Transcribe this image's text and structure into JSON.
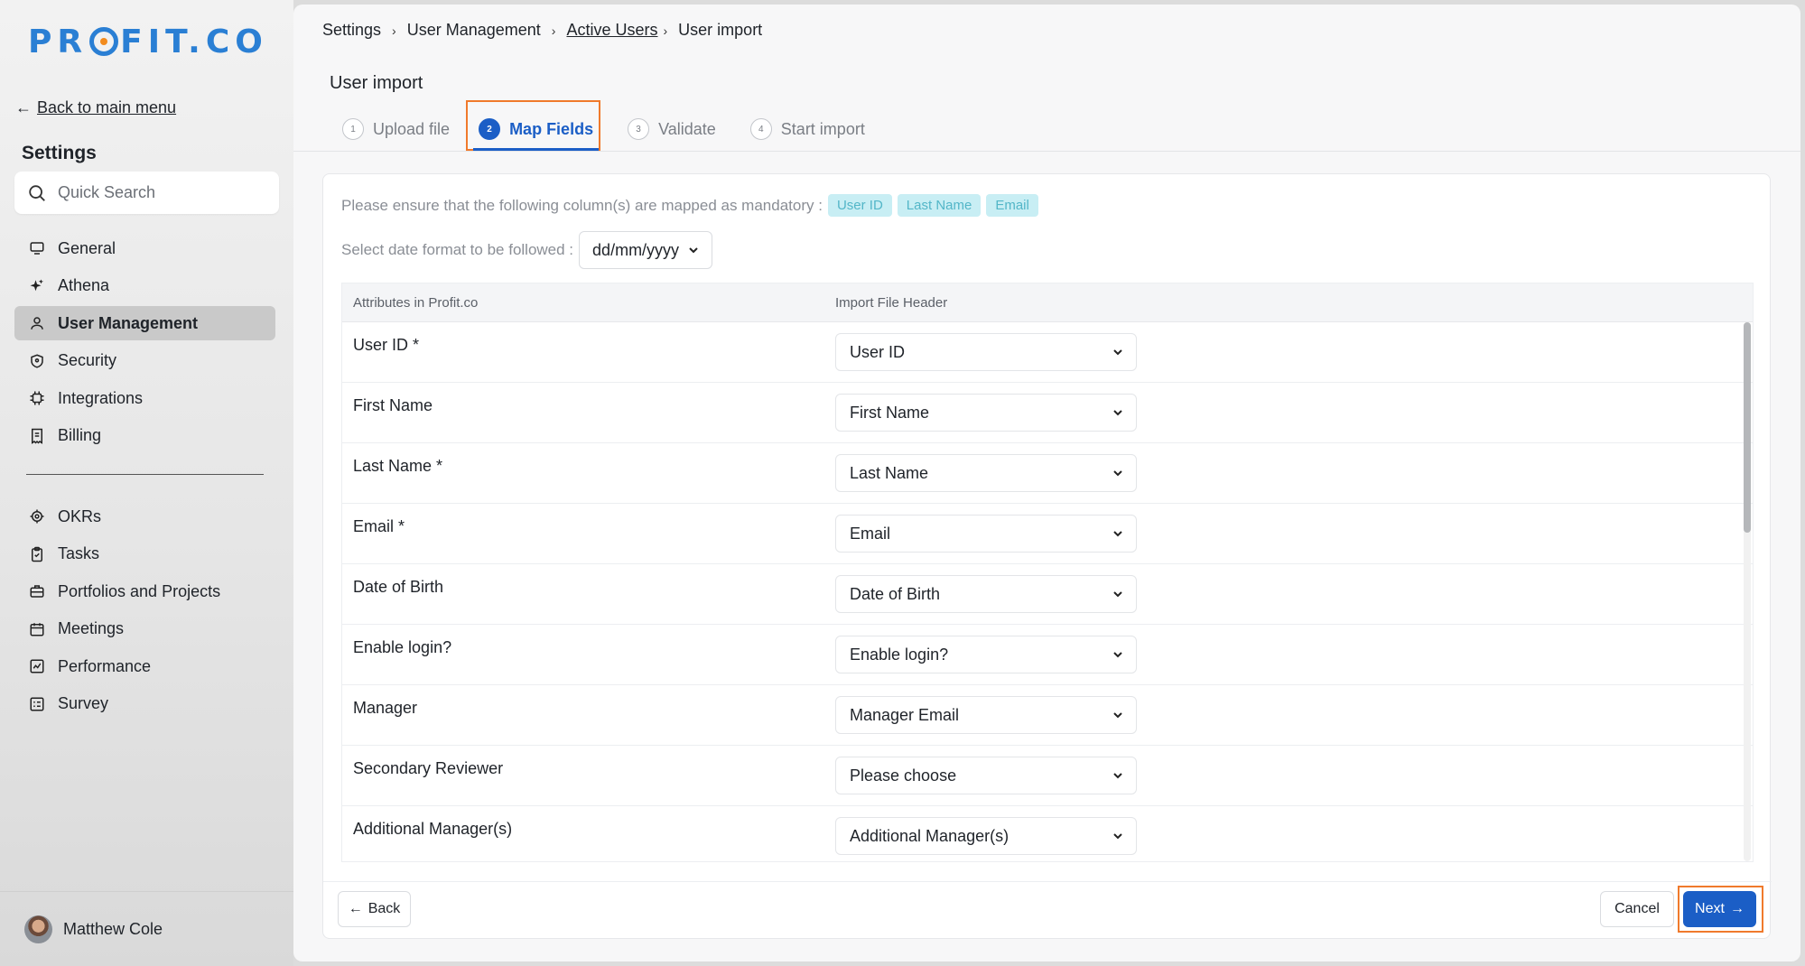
{
  "app": {
    "logo_text_1": "PR",
    "logo_text_2": "FIT.CO"
  },
  "sidebar": {
    "back_label": "Back to main menu",
    "section_title": "Settings",
    "search_placeholder": "Quick Search",
    "items": [
      {
        "label": "General",
        "icon": "monitor-icon"
      },
      {
        "label": "Athena",
        "icon": "sparkle-icon"
      },
      {
        "label": "User Management",
        "icon": "user-icon",
        "active": true
      },
      {
        "label": "Security",
        "icon": "shield-icon"
      },
      {
        "label": "Integrations",
        "icon": "chip-icon"
      },
      {
        "label": "Billing",
        "icon": "receipt-icon"
      }
    ],
    "items2": [
      {
        "label": "OKRs",
        "icon": "target-icon"
      },
      {
        "label": "Tasks",
        "icon": "clipboard-check-icon"
      },
      {
        "label": "Portfolios and Projects",
        "icon": "briefcase-icon"
      },
      {
        "label": "Meetings",
        "icon": "calendar-icon"
      },
      {
        "label": "Performance",
        "icon": "chart-line-icon"
      },
      {
        "label": "Survey",
        "icon": "survey-icon"
      }
    ],
    "user_name": "Matthew Cole"
  },
  "breadcrumb": {
    "items": [
      "Settings",
      "User Management",
      "Active Users",
      "User import"
    ]
  },
  "page_title": "User import",
  "steps": [
    {
      "num": "1",
      "label": "Upload file"
    },
    {
      "num": "2",
      "label": "Map Fields",
      "active": true
    },
    {
      "num": "3",
      "label": "Validate"
    },
    {
      "num": "4",
      "label": "Start import"
    }
  ],
  "mandatory": {
    "text": "Please ensure that the following column(s) are mapped as mandatory :",
    "chips": [
      "User ID",
      "Last Name",
      "Email"
    ]
  },
  "date_format": {
    "label": "Select date format to be followed :",
    "value": "dd/mm/yyyy"
  },
  "table": {
    "headers": [
      "Attributes in Profit.co",
      "Import File Header"
    ],
    "rows": [
      {
        "attribute": "User ID *",
        "mapping": "User ID"
      },
      {
        "attribute": "First Name",
        "mapping": "First Name"
      },
      {
        "attribute": "Last Name *",
        "mapping": "Last Name"
      },
      {
        "attribute": "Email *",
        "mapping": "Email"
      },
      {
        "attribute": "Date of Birth",
        "mapping": "Date of Birth"
      },
      {
        "attribute": "Enable login?",
        "mapping": "Enable login?"
      },
      {
        "attribute": "Manager",
        "mapping": "Manager Email"
      },
      {
        "attribute": "Secondary Reviewer",
        "mapping": "Please choose"
      },
      {
        "attribute": "Additional Manager(s)",
        "mapping": "Additional Manager(s)"
      }
    ]
  },
  "footer": {
    "back_label": "Back",
    "cancel_label": "Cancel",
    "next_label": "Next"
  },
  "colors": {
    "brand": "#2a7fd4",
    "accent": "#1b5ec6",
    "highlight": "#f07a2c",
    "chip_bg": "#c8eef4"
  }
}
